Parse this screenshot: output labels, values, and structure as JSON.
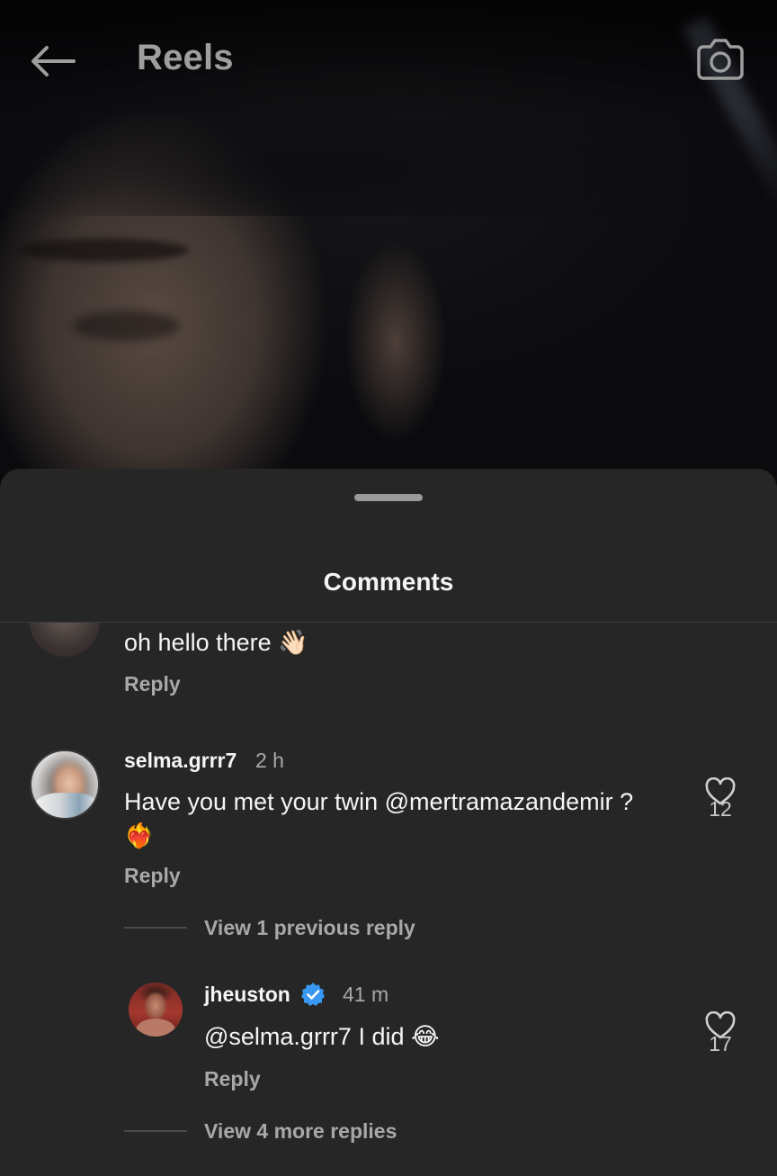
{
  "header": {
    "title": "Reels",
    "back_icon": "arrow-left-icon",
    "camera_icon": "camera-icon"
  },
  "sheet": {
    "title": "Comments"
  },
  "comments": [
    {
      "text": "oh hello there",
      "emoji": "👋🏻",
      "reply_label": "Reply"
    },
    {
      "username": "selma.grrr7",
      "time": "2 h",
      "text": "Have you met your twin @mertramazandemir ?",
      "emoji": "❤️‍🔥",
      "reply_label": "Reply",
      "likes": "12",
      "view_replies": "View 1 previous reply",
      "replies": [
        {
          "username": "jheuston",
          "verified": true,
          "time": "41 m",
          "text": "@selma.grrr7 I did",
          "emoji": "😂",
          "reply_label": "Reply",
          "likes": "17"
        }
      ],
      "more_replies": "View 4 more replies"
    }
  ],
  "colors": {
    "sheet_bg": "#262626",
    "text_primary": "#f5f5f5",
    "text_secondary": "#a8a8a8",
    "verified_blue": "#3897f0"
  }
}
